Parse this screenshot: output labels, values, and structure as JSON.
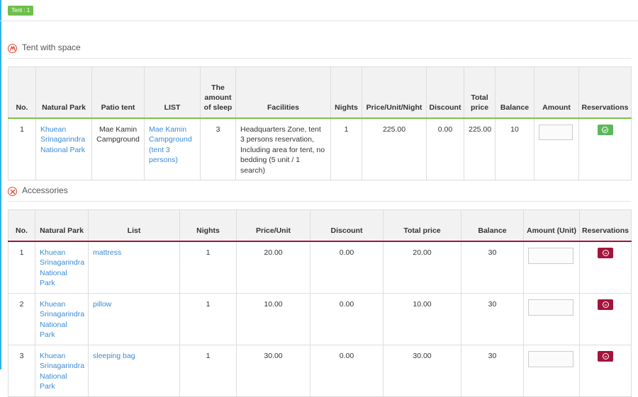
{
  "header": {
    "badge": "Tent : 1"
  },
  "tent_section": {
    "title": "Tent with space",
    "headers": [
      "No.",
      "Natural Park",
      "Patio tent",
      "LIST",
      "The amount of sleep",
      "Facilities",
      "Nights",
      "Price/Unit/Night",
      "Discount",
      "Total price",
      "Balance",
      "Amount",
      "Reservations"
    ],
    "rows": [
      {
        "no": "1",
        "park": "Khuean Srinagarindra National Park",
        "patio": "Mae Kamin Campground",
        "list": "Mae Kamin Campground (tent 3 persons)",
        "sleep": "3",
        "facilities": "Headquarters Zone, tent 3 persons reservation, Including area for tent, no bedding (5 unit / 1 search)",
        "nights": "1",
        "price": "225.00",
        "discount": "0.00",
        "total": "225.00",
        "balance": "10",
        "amount": ""
      }
    ]
  },
  "accessories_section": {
    "title": "Accessories",
    "headers": [
      "No.",
      "Natural Park",
      "List",
      "Nights",
      "Price/Unit",
      "Discount",
      "Total price",
      "Balance",
      "Amount (Unit)",
      "Reservations"
    ],
    "rows": [
      {
        "no": "1",
        "park": "Khuean Srinagarindra National Park",
        "list": "mattress",
        "nights": "1",
        "price": "20.00",
        "discount": "0.00",
        "total": "20.00",
        "balance": "30",
        "amount": ""
      },
      {
        "no": "2",
        "park": "Khuean Srinagarindra National Park",
        "list": "pillow",
        "nights": "1",
        "price": "10.00",
        "discount": "0.00",
        "total": "10.00",
        "balance": "30",
        "amount": ""
      },
      {
        "no": "3",
        "park": "Khuean Srinagarindra National Park",
        "list": "sleeping bag",
        "nights": "1",
        "price": "30.00",
        "discount": "0.00",
        "total": "30.00",
        "balance": "30",
        "amount": ""
      }
    ]
  },
  "icons": {
    "tent_section": "tent-icon",
    "accessories_section": "tools-icon",
    "reserve_add": "check-circle-icon",
    "reserve_remove": "minus-circle-icon"
  },
  "colors": {
    "accent_left": "#2eb4e6",
    "badge": "#6fbf4a",
    "tent_header_line": "#7cc24f",
    "acc_header_line": "#a3143c",
    "link": "#3a8ad6",
    "btn_green": "#5cb85c",
    "btn_red": "#a3143c"
  }
}
